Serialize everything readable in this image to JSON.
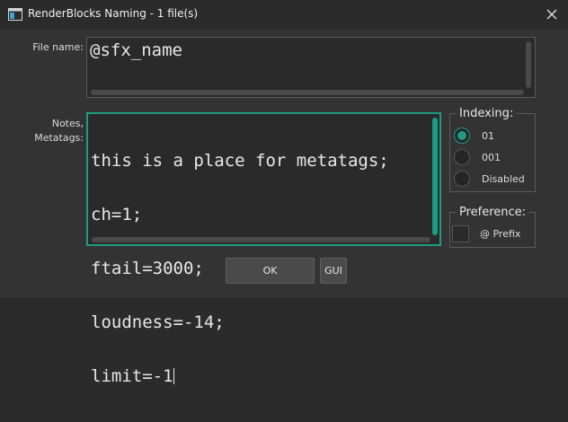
{
  "window": {
    "title": "RenderBlocks Naming - 1 file(s)",
    "close_icon": "close-icon",
    "app_icon": "window-app-icon"
  },
  "filename": {
    "label": "File name:",
    "value": "@sfx_name"
  },
  "metatags": {
    "label_line1": "Notes,",
    "label_line2": "Metatags:",
    "lines": [
      "this is a place for metatags;",
      "ch=1;",
      "ftail=3000;",
      "loudness=-14;",
      "limit=-1"
    ],
    "accent": "#1e9b82"
  },
  "indexing": {
    "title": "Indexing:",
    "options": [
      "01",
      "001",
      "Disabled"
    ],
    "selected": "01"
  },
  "preference": {
    "title": "Preference:",
    "prefix_label": "@ Prefix",
    "prefix_checked": false
  },
  "buttons": {
    "ok": "OK",
    "gui": "GUI"
  }
}
